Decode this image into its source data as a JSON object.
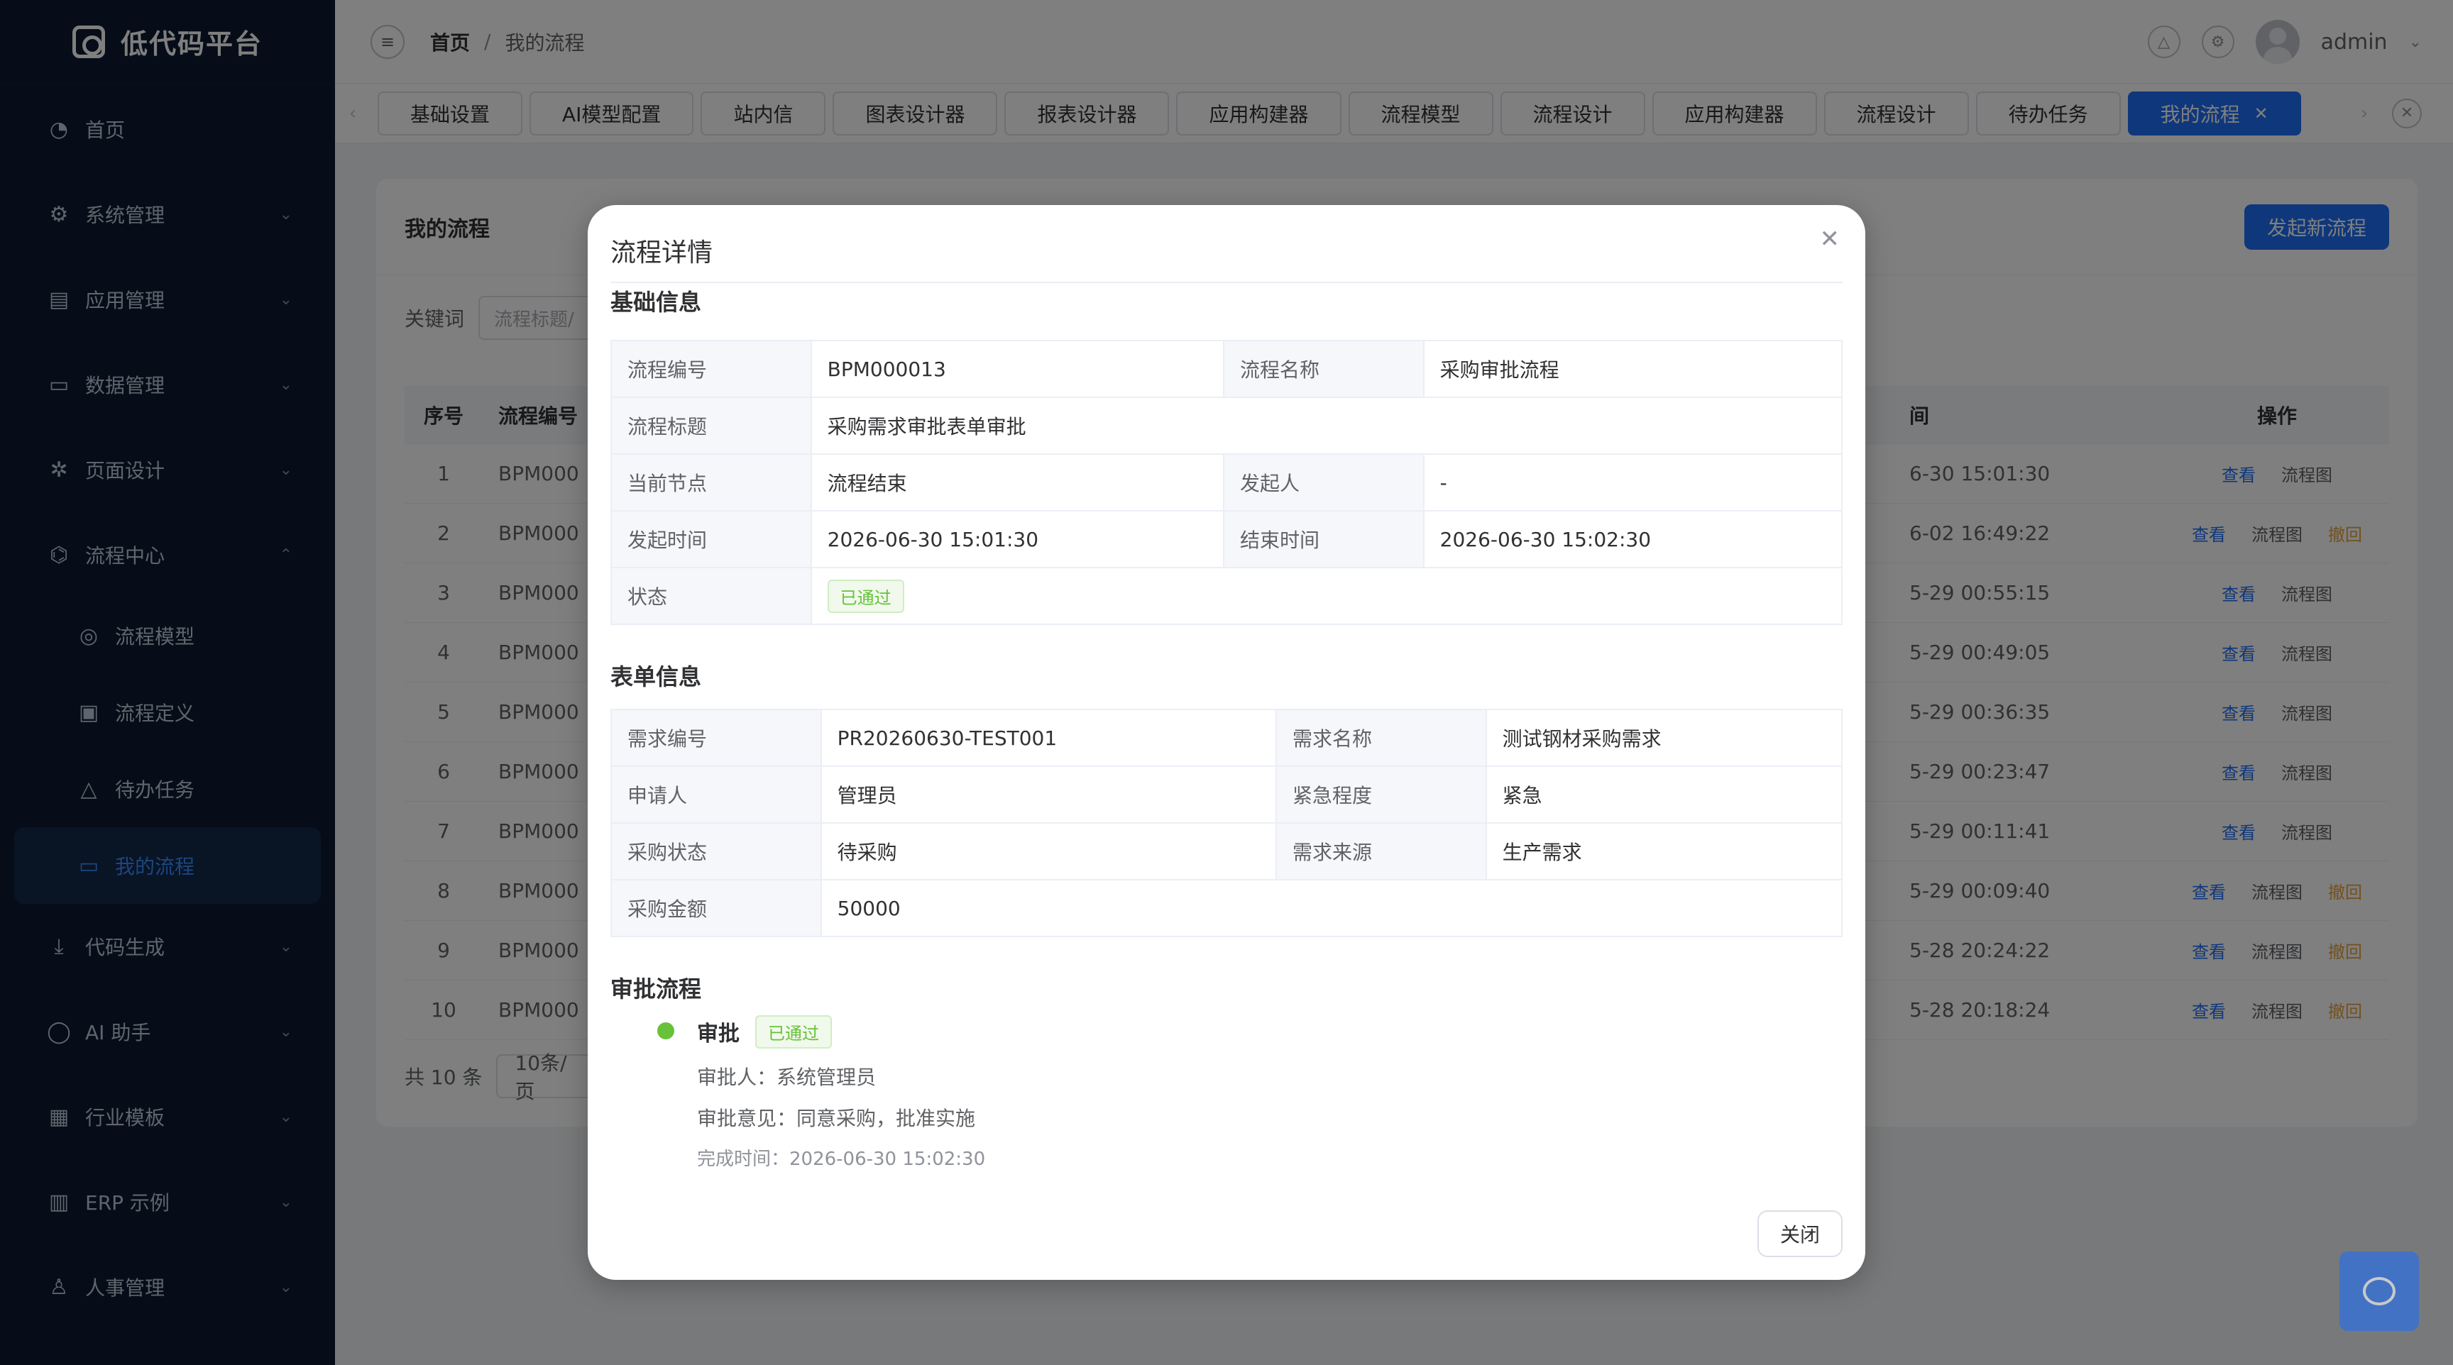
{
  "app": {
    "title": "低代码平台"
  },
  "sidebar": {
    "items": [
      {
        "label": "首页",
        "icon": "dashboard-icon",
        "expandable": false
      },
      {
        "label": "系统管理",
        "icon": "gear-icon",
        "expandable": true
      },
      {
        "label": "应用管理",
        "icon": "document-icon",
        "expandable": true
      },
      {
        "label": "数据管理",
        "icon": "monitor-icon",
        "expandable": true
      },
      {
        "label": "页面设计",
        "icon": "sparkle-icon",
        "expandable": true
      },
      {
        "label": "流程中心",
        "icon": "flow-icon",
        "expandable": true,
        "expanded": true
      },
      {
        "label": "流程模型",
        "icon": "model-icon",
        "sub": true
      },
      {
        "label": "流程定义",
        "icon": "list-icon",
        "sub": true
      },
      {
        "label": "待办任务",
        "icon": "bell-icon",
        "sub": true
      },
      {
        "label": "我的流程",
        "icon": "folder-icon",
        "sub": true,
        "active": true
      },
      {
        "label": "代码生成",
        "icon": "download-icon",
        "expandable": true
      },
      {
        "label": "AI 助手",
        "icon": "chat-icon",
        "expandable": true
      },
      {
        "label": "行业模板",
        "icon": "grid-icon",
        "expandable": true
      },
      {
        "label": "ERP 示例",
        "icon": "building-icon",
        "expandable": true
      },
      {
        "label": "人事管理",
        "icon": "user-icon",
        "expandable": true
      }
    ]
  },
  "header": {
    "breadcrumb": [
      "首页",
      "我的流程"
    ],
    "sep": "/",
    "user": "admin"
  },
  "tags": [
    "基础设置",
    "AI模型配置",
    "站内信",
    "图表设计器",
    "报表设计器",
    "应用构建器",
    "流程模型",
    "流程设计",
    "应用构建器",
    "流程设计",
    "待办任务",
    "我的流程"
  ],
  "page": {
    "title": "我的流程",
    "new_button": "发起新流程",
    "keyword_label": "关键词",
    "keyword_placeholder": "流程标题/",
    "columns": {
      "no": "序号",
      "code": "流程编号",
      "time": "间",
      "ops": "操作"
    },
    "rows": [
      {
        "no": "1",
        "code": "BPM000",
        "time": "6-30 15:01:30",
        "ops": [
          "查看",
          "流程图"
        ]
      },
      {
        "no": "2",
        "code": "BPM000",
        "time": "6-02 16:49:22",
        "ops": [
          "查看",
          "流程图",
          "撤回"
        ]
      },
      {
        "no": "3",
        "code": "BPM000",
        "time": "5-29 00:55:15",
        "ops": [
          "查看",
          "流程图"
        ]
      },
      {
        "no": "4",
        "code": "BPM000",
        "time": "5-29 00:49:05",
        "ops": [
          "查看",
          "流程图"
        ]
      },
      {
        "no": "5",
        "code": "BPM000",
        "time": "5-29 00:36:35",
        "ops": [
          "查看",
          "流程图"
        ]
      },
      {
        "no": "6",
        "code": "BPM000",
        "time": "5-29 00:23:47",
        "ops": [
          "查看",
          "流程图"
        ]
      },
      {
        "no": "7",
        "code": "BPM000",
        "time": "5-29 00:11:41",
        "ops": [
          "查看",
          "流程图"
        ]
      },
      {
        "no": "8",
        "code": "BPM000",
        "time": "5-29 00:09:40",
        "ops": [
          "查看",
          "流程图",
          "撤回"
        ]
      },
      {
        "no": "9",
        "code": "BPM000",
        "time": "5-28 20:24:22",
        "ops": [
          "查看",
          "流程图",
          "撤回"
        ]
      },
      {
        "no": "10",
        "code": "BPM000",
        "time": "5-28 20:18:24",
        "ops": [
          "查看",
          "流程图",
          "撤回"
        ]
      }
    ],
    "total": "共 10 条",
    "page_size": "10条/页"
  },
  "modal": {
    "title": "流程详情",
    "basic_title": "基础信息",
    "basic": {
      "code_k": "流程编号",
      "code_v": "BPM000013",
      "name_k": "流程名称",
      "name_v": "采购审批流程",
      "title_k": "流程标题",
      "title_v": "采购需求审批表单审批",
      "node_k": "当前节点",
      "node_v": "流程结束",
      "starter_k": "发起人",
      "starter_v": "-",
      "start_k": "发起时间",
      "start_v": "2026-06-30 15:01:30",
      "end_k": "结束时间",
      "end_v": "2026-06-30 15:02:30",
      "status_k": "状态",
      "status_v": "已通过"
    },
    "form_title": "表单信息",
    "form": {
      "req_no_k": "需求编号",
      "req_no_v": "PR20260630-TEST001",
      "req_name_k": "需求名称",
      "req_name_v": "测试钢材采购需求",
      "applicant_k": "申请人",
      "applicant_v": "管理员",
      "urgency_k": "紧急程度",
      "urgency_v": "紧急",
      "pstatus_k": "采购状态",
      "pstatus_v": "待采购",
      "source_k": "需求来源",
      "source_v": "生产需求",
      "amount_k": "采购金额",
      "amount_v": "50000"
    },
    "approval_title": "审批流程",
    "approval": {
      "node": "审批",
      "badge": "已通过",
      "approver": "审批人：系统管理员",
      "opinion": "审批意见：同意采购，批准实施",
      "time": "完成时间：2026-06-30 15:02:30"
    },
    "close_button": "关闭"
  },
  "colors": {
    "primary": "#1f6ef6",
    "sidebar_bg": "#0c1a30",
    "success": "#67c23a",
    "warning": "#e6a23c"
  }
}
